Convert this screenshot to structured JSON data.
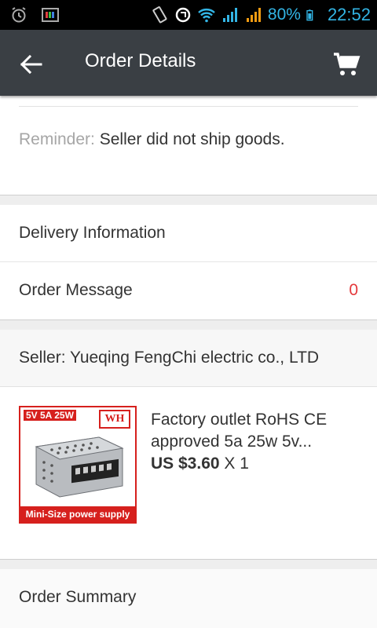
{
  "status_bar": {
    "battery": "80%",
    "time": "22:52",
    "icons": [
      "alarm-icon",
      "image-icon",
      "vibrate-icon",
      "sync-icon",
      "wifi-icon",
      "signal-icon",
      "signal-icon",
      "battery-icon"
    ]
  },
  "app_bar": {
    "title": "Order Details",
    "back_icon": "arrow-back-icon",
    "cart_icon": "cart-icon"
  },
  "reminder": {
    "label": "Reminder:",
    "text": "Seller did not ship goods."
  },
  "rows": {
    "delivery": "Delivery Information",
    "message": "Order Message",
    "message_count": "0"
  },
  "seller": {
    "label": "Seller: Yueqing FengChi electric co., LTD"
  },
  "product": {
    "title": "Factory outlet RoHS CE approved 5a 25w 5v...",
    "price": "US $3.60",
    "quantity": "X 1",
    "image_top_text": "5V 5A 25W",
    "image_logo": "WH",
    "image_bottom_text": "Mini-Size power supply"
  },
  "summary": {
    "label": "Order Summary"
  },
  "colors": {
    "app_bar": "#3a3f44",
    "status_accent": "#33b5e5",
    "count_red": "#e4393c",
    "thumb_red": "#d6201d"
  }
}
